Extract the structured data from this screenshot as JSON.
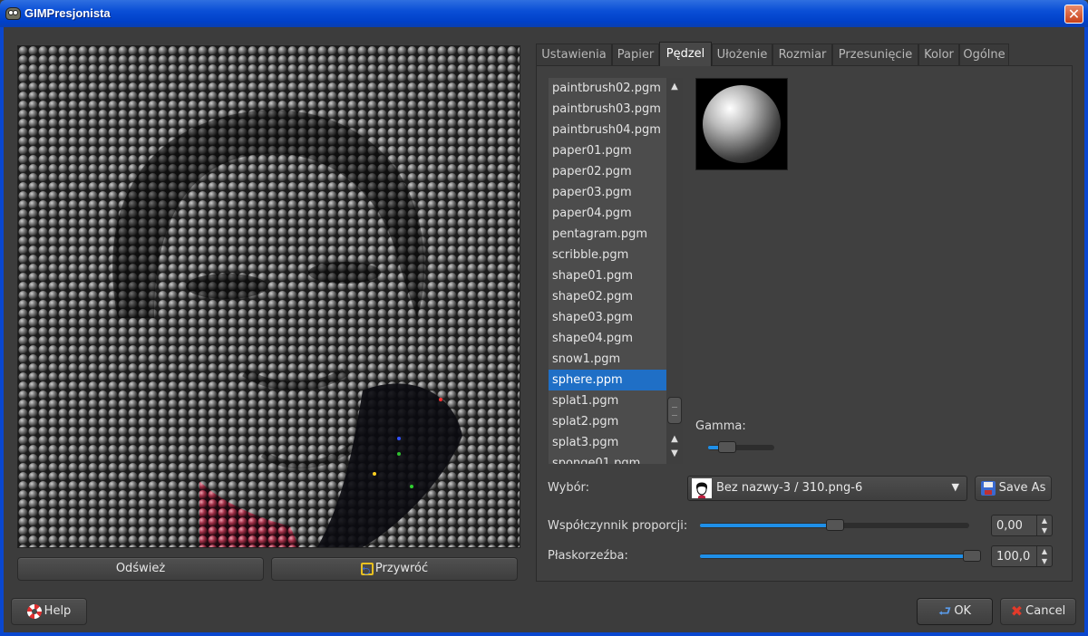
{
  "window": {
    "title": "GIMPresjonista",
    "close_glyph": "✕"
  },
  "preview": {
    "refresh_label": "Odśwież",
    "restore_label": "Przywróć"
  },
  "tabs": [
    {
      "label": "Ustawienia",
      "active": false
    },
    {
      "label": "Papier",
      "active": false
    },
    {
      "label": "Pędzel",
      "active": true
    },
    {
      "label": "Ułożenie",
      "active": false
    },
    {
      "label": "Rozmiar",
      "active": false
    },
    {
      "label": "Przesunięcie",
      "active": false
    },
    {
      "label": "Kolor",
      "active": false
    },
    {
      "label": "Ogólne",
      "active": false
    }
  ],
  "brush": {
    "items": [
      "paintbrush02.pgm",
      "paintbrush03.pgm",
      "paintbrush04.pgm",
      "paper01.pgm",
      "paper02.pgm",
      "paper03.pgm",
      "paper04.pgm",
      "pentagram.pgm",
      "scribble.pgm",
      "shape01.pgm",
      "shape02.pgm",
      "shape03.pgm",
      "shape04.pgm",
      "snow1.pgm",
      "sphere.ppm",
      "splat1.pgm",
      "splat2.pgm",
      "splat3.pgm",
      "sponge01.pgm"
    ],
    "selected": "sphere.ppm",
    "gamma_label": "Gamma:",
    "gamma_fraction": 0.2
  },
  "selection": {
    "label": "Wybór:",
    "value": "Bez nazwy-3 / 310.png-6",
    "save_as_label": "Save As"
  },
  "aspect": {
    "label": "Współczynnik proporcji:",
    "value": "0,00",
    "fraction": 0.5
  },
  "relief": {
    "label": "Płaskorzeźba:",
    "value": "100,0",
    "fraction": 1.0
  },
  "footer": {
    "help_label": "Help",
    "ok_label": "OK",
    "cancel_label": "Cancel"
  },
  "colors": {
    "selection": "#1f6fc6",
    "slider_fill": "#1f8fe8",
    "titlebar": "#0a4fd6"
  }
}
